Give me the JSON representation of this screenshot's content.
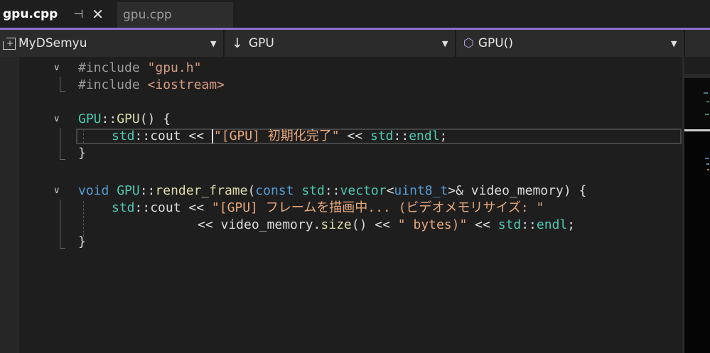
{
  "tabs": {
    "active": {
      "title": "gpu.cpp",
      "pin": "⊣",
      "close": "✕"
    },
    "inactive": {
      "title": "gpu.cpp"
    }
  },
  "navbar": {
    "project": "MyDSemyu",
    "project_icon": "+",
    "scope_icon": "↓",
    "scope": "GPU",
    "member_icon": "⬡",
    "member": "GPU()",
    "dropdown_glyph": "▼"
  },
  "colors": {
    "accent": "#8c6fd1",
    "keyword": "#569cd6",
    "type": "#4ec9b0",
    "function": "#dcdcaa",
    "string": "#d69d85"
  },
  "code": {
    "include1": {
      "directive": "#include ",
      "file": "\"gpu.h\""
    },
    "include2": {
      "directive": "#include ",
      "file": "<iostream>"
    },
    "ctor": {
      "cls": "GPU",
      "sep": "::",
      "name": "GPU",
      "rest": "() {"
    },
    "ctor_body": {
      "std1": "std",
      "sep1": "::",
      "cout": "cout",
      "op1": " << ",
      "str": "\"[GPU] 初期化完了\"",
      "op2": " << ",
      "std2": "std",
      "sep2": "::",
      "endl": "endl",
      "semi": ";"
    },
    "close1": "}",
    "render": {
      "void": "void",
      "cls": "GPU",
      "sep": "::",
      "name": "render_frame",
      "p1": "(",
      "const": "const",
      "std": " std",
      "sep2": "::",
      "vector": "vector",
      "lt": "<",
      "u8": "uint8_t",
      "gt": ">& video_memory) {"
    },
    "render_body1": {
      "std1": "std",
      "sep1": "::",
      "cout": "cout",
      "op1": " << ",
      "str": "\"[GPU] フレームを描画中... (ビデオメモリサイズ: \""
    },
    "render_body2": {
      "op": "<< video_memory.",
      "size": "size",
      "rest": "() << ",
      "str": "\" bytes)\"",
      "op2": " << ",
      "std": "std",
      "sep": "::",
      "endl": "endl",
      "semi": ";"
    },
    "close2": "}"
  }
}
